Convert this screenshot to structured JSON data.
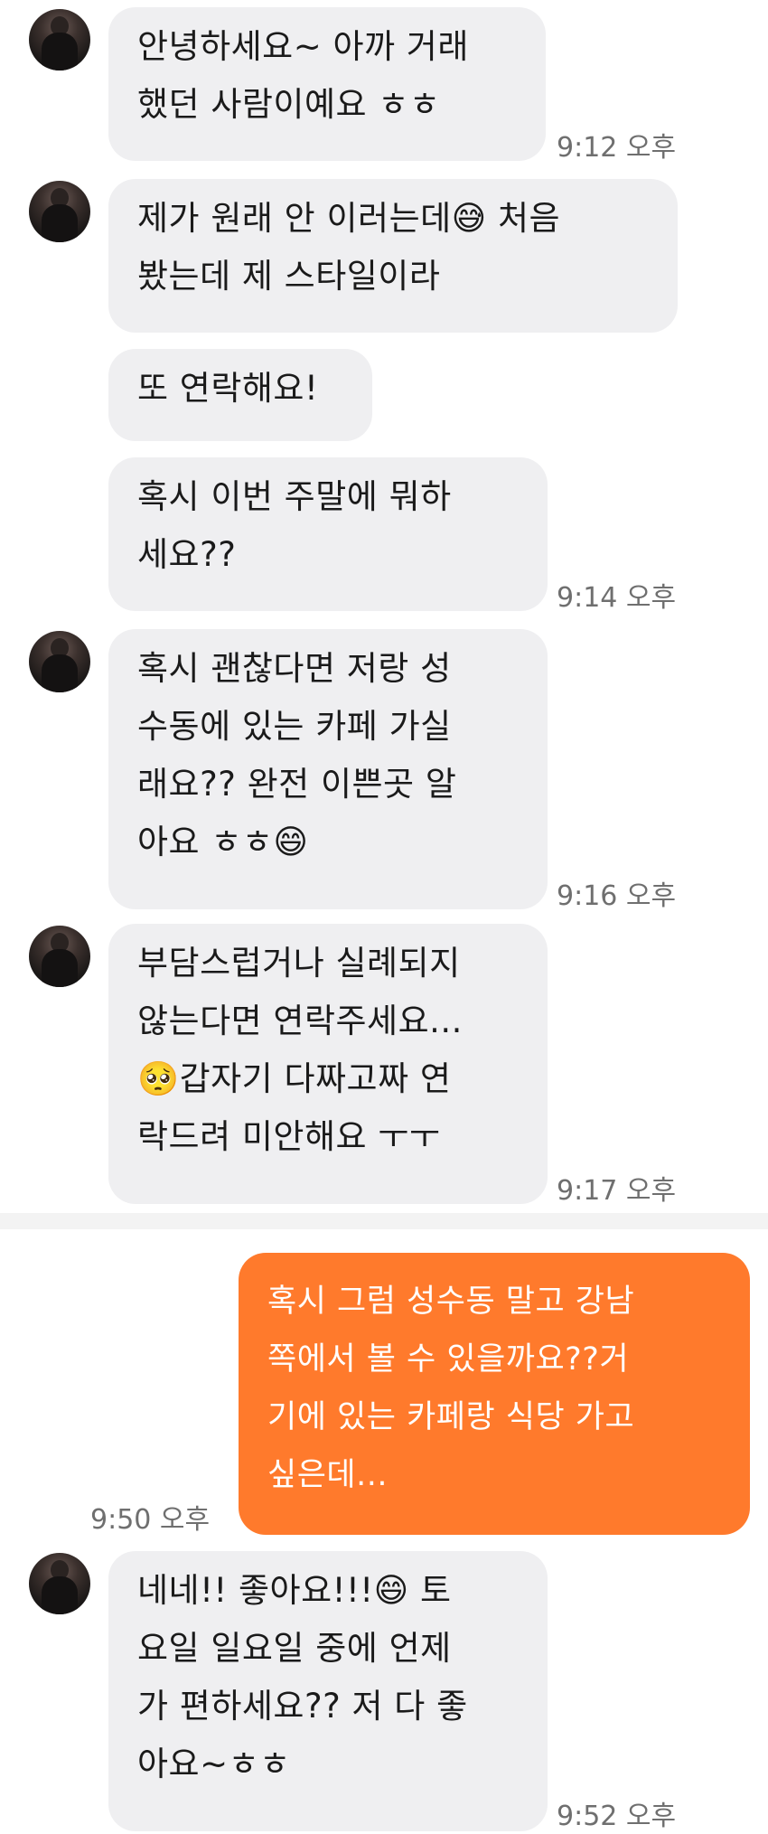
{
  "messages": [
    {
      "text": "안녕하세요~ 아까 거래\n했던 사람이예요 ㅎㅎ",
      "time": "9:12 오후"
    },
    {
      "text": "제가 원래 안 이러는데😅 처음\n봤는데 제 스타일이라"
    },
    {
      "text": "또 연락해요!"
    },
    {
      "text": "혹시 이번 주말에 뭐하\n세요??",
      "time": "9:14 오후"
    },
    {
      "text": "혹시 괜찮다면 저랑 성\n수동에 있는 카페 가실\n래요?? 완전 이쁜곳 알\n아요 ㅎㅎ😄",
      "time": "9:16 오후"
    },
    {
      "text": "부담스럽거나 실례되지\n않는다면 연락주세요...\n🥺갑자기 다짜고짜 연\n락드려 미안해요 ㅜㅜ",
      "time": "9:17 오후"
    },
    {
      "text": "혹시 그럼 성수동 말고 강남\n쪽에서 볼 수 있을까요??거\n기에 있는 카페랑 식당 가고\n싶은데...",
      "time": "9:50 오후"
    },
    {
      "text": "네네!! 좋아요!!!😄 토\n요일 일요일 중에 언제\n가 편하세요?? 저 다 좋\n아요~ㅎㅎ",
      "time": "9:52 오후"
    }
  ],
  "colors": {
    "received_bubble": "#efeff1",
    "sent_bubble": "#ff7a2c",
    "timestamp": "#6f6f6f"
  },
  "icons": [
    "avatar"
  ]
}
